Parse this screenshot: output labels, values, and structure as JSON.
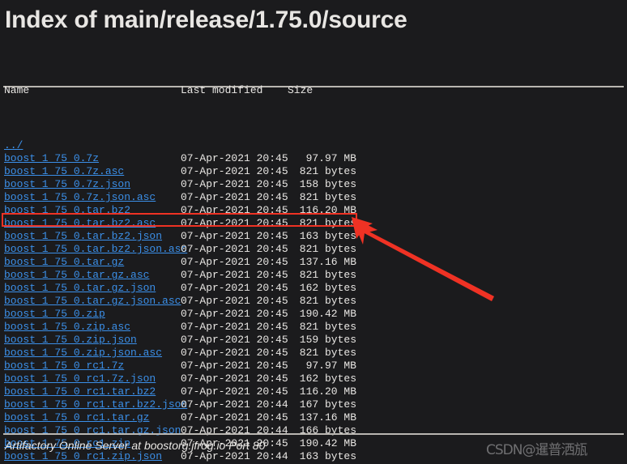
{
  "page": {
    "title": "Index of main/release/1.75.0/source",
    "background_color": "#1b1b1d",
    "text_color": "#e8e6e3",
    "link_color": "#3b8fe8",
    "annotation_color": "#ef3224"
  },
  "table": {
    "headers": {
      "name": "Name",
      "last_modified": "Last modified",
      "size": "Size"
    },
    "parent_link": "../",
    "rows": [
      {
        "name": "boost_1_75_0.7z",
        "modified": "07-Apr-2021 20:45",
        "size": "97.97 MB"
      },
      {
        "name": "boost_1_75_0.7z.asc",
        "modified": "07-Apr-2021 20:45",
        "size": "821 bytes"
      },
      {
        "name": "boost_1_75_0.7z.json",
        "modified": "07-Apr-2021 20:45",
        "size": "158 bytes"
      },
      {
        "name": "boost_1_75_0.7z.json.asc",
        "modified": "07-Apr-2021 20:45",
        "size": "821 bytes"
      },
      {
        "name": "boost_1_75_0.tar.bz2",
        "modified": "07-Apr-2021 20:45",
        "size": "116.20 MB"
      },
      {
        "name": "boost_1_75_0.tar.bz2.asc",
        "modified": "07-Apr-2021 20:45",
        "size": "821 bytes"
      },
      {
        "name": "boost_1_75_0.tar.bz2.json",
        "modified": "07-Apr-2021 20:45",
        "size": "163 bytes"
      },
      {
        "name": "boost_1_75_0.tar.bz2.json.asc",
        "modified": "07-Apr-2021 20:45",
        "size": "821 bytes"
      },
      {
        "name": "boost_1_75_0.tar.gz",
        "modified": "07-Apr-2021 20:45",
        "size": "137.16 MB"
      },
      {
        "name": "boost_1_75_0.tar.gz.asc",
        "modified": "07-Apr-2021 20:45",
        "size": "821 bytes"
      },
      {
        "name": "boost_1_75_0.tar.gz.json",
        "modified": "07-Apr-2021 20:45",
        "size": "162 bytes"
      },
      {
        "name": "boost_1_75_0.tar.gz.json.asc",
        "modified": "07-Apr-2021 20:45",
        "size": "821 bytes"
      },
      {
        "name": "boost_1_75_0.zip",
        "modified": "07-Apr-2021 20:45",
        "size": "190.42 MB"
      },
      {
        "name": "boost_1_75_0.zip.asc",
        "modified": "07-Apr-2021 20:45",
        "size": "821 bytes"
      },
      {
        "name": "boost_1_75_0.zip.json",
        "modified": "07-Apr-2021 20:45",
        "size": "159 bytes"
      },
      {
        "name": "boost_1_75_0.zip.json.asc",
        "modified": "07-Apr-2021 20:45",
        "size": "821 bytes"
      },
      {
        "name": "boost_1_75_0_rc1.7z",
        "modified": "07-Apr-2021 20:45",
        "size": "97.97 MB"
      },
      {
        "name": "boost_1_75_0_rc1.7z.json",
        "modified": "07-Apr-2021 20:45",
        "size": "162 bytes"
      },
      {
        "name": "boost_1_75_0_rc1.tar.bz2",
        "modified": "07-Apr-2021 20:45",
        "size": "116.20 MB"
      },
      {
        "name": "boost_1_75_0_rc1.tar.bz2.json",
        "modified": "07-Apr-2021 20:44",
        "size": "167 bytes"
      },
      {
        "name": "boost_1_75_0_rc1.tar.gz",
        "modified": "07-Apr-2021 20:45",
        "size": "137.16 MB"
      },
      {
        "name": "boost_1_75_0_rc1.tar.gz.json",
        "modified": "07-Apr-2021 20:44",
        "size": "166 bytes"
      },
      {
        "name": "boost_1_75_0_rc1.zip",
        "modified": "07-Apr-2021 20:45",
        "size": "190.42 MB"
      },
      {
        "name": "boost_1_75_0_rc1.zip.json",
        "modified": "07-Apr-2021 20:44",
        "size": "163 bytes"
      }
    ],
    "highlighted_row_index": 8
  },
  "footer": {
    "text": "Artifactory Online Server at boostorg.jfrog.io Port 80"
  },
  "watermark": {
    "text": "CSDN@暹普洒瓬"
  }
}
